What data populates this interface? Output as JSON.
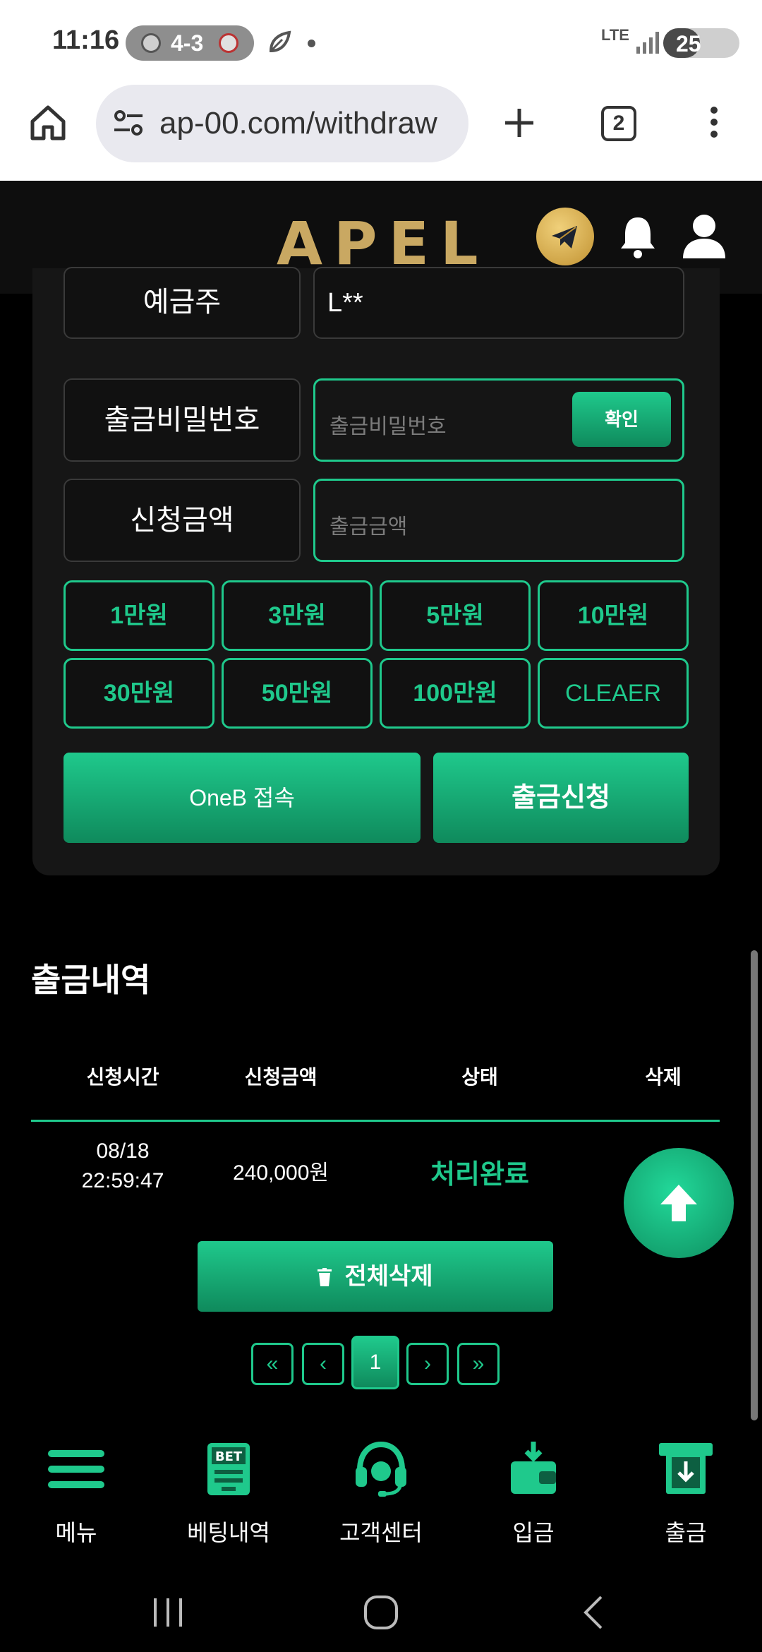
{
  "status_bar": {
    "time": "11:16",
    "score": "4-3",
    "network": "LTE",
    "battery": "25"
  },
  "browser": {
    "url": "ap-00.com/withdraw",
    "tab_count": "2"
  },
  "header": {
    "logo": "APEL"
  },
  "form": {
    "account_holder_label": "예금주",
    "account_holder_value": "L**",
    "password_label": "출금비밀번호",
    "password_placeholder": "출금비밀번호",
    "confirm_label": "확인",
    "amount_label": "신청금액",
    "amount_placeholder": "출금금액",
    "amount_buttons": [
      "1만원",
      "3만원",
      "5만원",
      "10만원",
      "30만원",
      "50만원",
      "100만원",
      "CLEAER"
    ],
    "oneb_label": "OneB 접속",
    "submit_label": "출금신청"
  },
  "history": {
    "title": "출금내역",
    "columns": [
      "신청시간",
      "신청금액",
      "상태",
      "삭제"
    ],
    "rows": [
      {
        "date": "08/18",
        "time": "22:59:47",
        "amount": "240,000원",
        "status": "처리완료"
      }
    ],
    "delete_all_label": "전체삭제",
    "pagination": {
      "first": "«",
      "prev": "‹",
      "current": "1",
      "next": "›",
      "last": "»"
    }
  },
  "bottom_nav": [
    {
      "label": "메뉴",
      "icon": "menu-icon"
    },
    {
      "label": "베팅내역",
      "icon": "bet-icon"
    },
    {
      "label": "고객센터",
      "icon": "headset-icon"
    },
    {
      "label": "입금",
      "icon": "wallet-icon"
    },
    {
      "label": "출금",
      "icon": "withdraw-icon"
    }
  ],
  "colors": {
    "accent": "#1fc98c",
    "accent_dark": "#0f8a5c",
    "gold": "#c9a862",
    "background": "#000000"
  }
}
